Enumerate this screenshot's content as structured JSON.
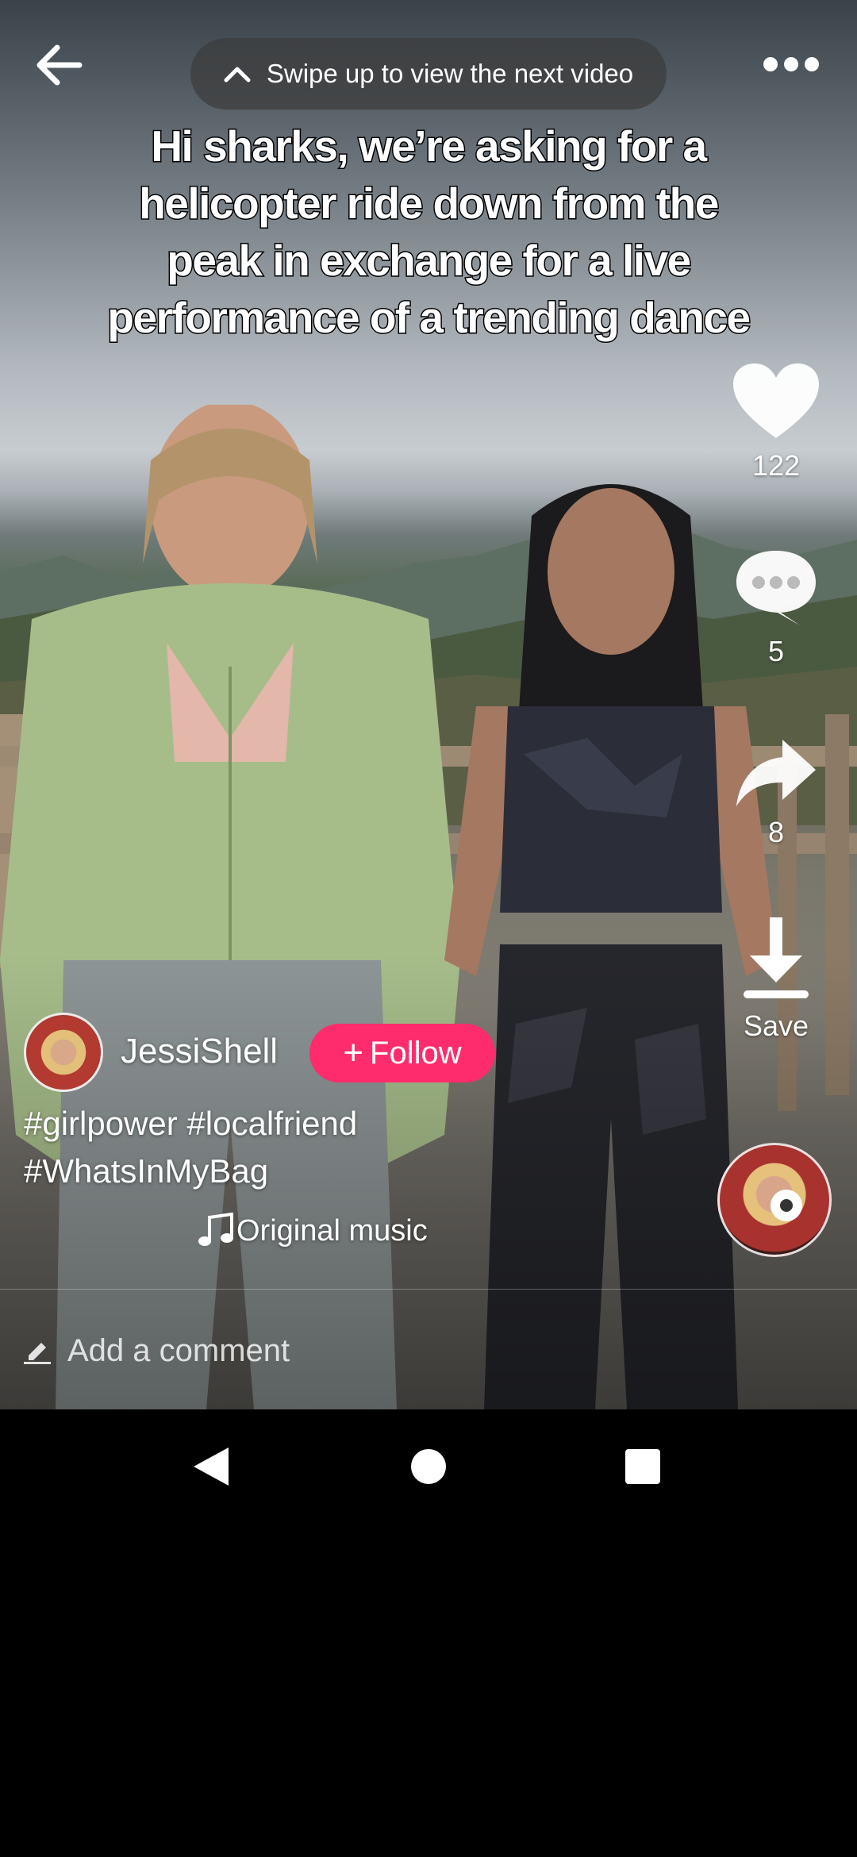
{
  "top_bar": {
    "swipe_hint": "Swipe up to view the next video",
    "back_icon": "arrow-left-icon",
    "more_icon": "more-horizontal-icon",
    "hint_icon": "chevron-up-icon"
  },
  "video": {
    "caption_lines": [
      "Hi sharks, we’re asking for a",
      "helicopter ride down from the",
      "peak in exchange for a live",
      "performance of a trending dance"
    ]
  },
  "rail": {
    "like_count": "122",
    "comment_count": "5",
    "share_count": "8",
    "save_label": "Save",
    "like_icon": "heart-icon",
    "comment_icon": "comment-bubble-icon",
    "share_icon": "share-arrow-icon",
    "save_icon": "download-icon"
  },
  "creator": {
    "username": "JessiShell",
    "follow_label": "Follow",
    "hashtags": [
      "#girlpower #localfriend",
      "#WhatsInMyBag"
    ],
    "music": "Original music",
    "music_icon": "music-note-icon"
  },
  "comment": {
    "placeholder": "Add a comment",
    "icon": "pencil-icon"
  },
  "navbar": {
    "back": "nav-back-icon",
    "home": "nav-home-icon",
    "recents": "nav-recents-icon"
  },
  "colors": {
    "follow": "#fe2c6d",
    "background": "#000000"
  }
}
